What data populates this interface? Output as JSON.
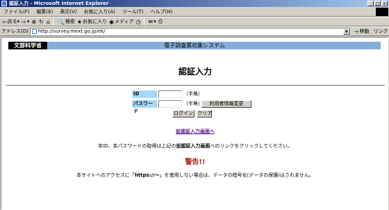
{
  "window": {
    "title": "認証入力 - Microsoft Internet Explorer",
    "controls": [
      "_",
      "□",
      "×"
    ]
  },
  "menu": [
    "ファイル(F)",
    "編集(E)",
    "表示(V)",
    "お気に入り(A)",
    "ツール(T)",
    "ヘルプ(H)"
  ],
  "toolbar": {
    "back": "戻る",
    "search": "検索",
    "favorites": "お気に入り",
    "media": "メディア"
  },
  "address": {
    "label": "アドレス(D)",
    "url": "http://survey.mext.go.jp/ek/",
    "go": "移動",
    "links": "リンク"
  },
  "page": {
    "org": "文部科学省",
    "system": "電子調査票収集システム",
    "heading": "認証入力",
    "id_label": "ID",
    "password_label": "パスワード",
    "halfwidth_1": "（半角）",
    "halfwidth_2": "（半角）",
    "change_button": "利用者情報変更",
    "login_button": "ログイン",
    "clear_button": "クリア",
    "temp_link": "仮認証入力画面へ",
    "note_prefix": "本ID、本パスワードの取得は上記の",
    "note_bold": "仮認証入力画面",
    "note_suffix": "へのリンクをクリックしてください。",
    "warning": "警告!!",
    "warn_prefix": "本サイトへのアクセスに「",
    "warn_bold": "https://～",
    "warn_suffix": "」を使用しない場合は、データの暗号化(データの保護)はされません。"
  }
}
